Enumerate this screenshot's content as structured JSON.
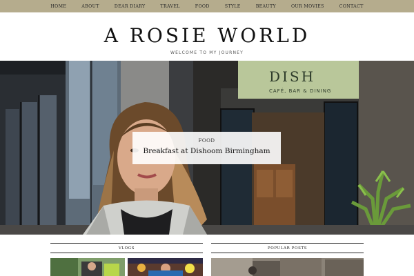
{
  "nav": {
    "items": [
      {
        "label": "HOME"
      },
      {
        "label": "ABOUT"
      },
      {
        "label": "DEAR DIARY"
      },
      {
        "label": "TRAVEL"
      },
      {
        "label": "FOOD"
      },
      {
        "label": "STYLE"
      },
      {
        "label": "BEAUTY"
      },
      {
        "label": "OUR MOVIES"
      },
      {
        "label": "CONTACT"
      }
    ]
  },
  "header": {
    "title": "A ROSIE WORLD",
    "tagline": "WELCOME TO MY JOURNEY"
  },
  "hero": {
    "category": "FOOD",
    "post_title": "Breakfast at Dishoom Birmingham",
    "sign_text": "CAFÉ, BAR & DINING",
    "sign_partial": "DISH"
  },
  "widgets": {
    "vlogs": {
      "heading": "VLOGS"
    },
    "popular": {
      "heading": "POPULAR POSTS"
    }
  },
  "colors": {
    "nav_bg": "#b5ac8d",
    "sign_green": "#b9c79a",
    "text_dark": "#111111"
  }
}
